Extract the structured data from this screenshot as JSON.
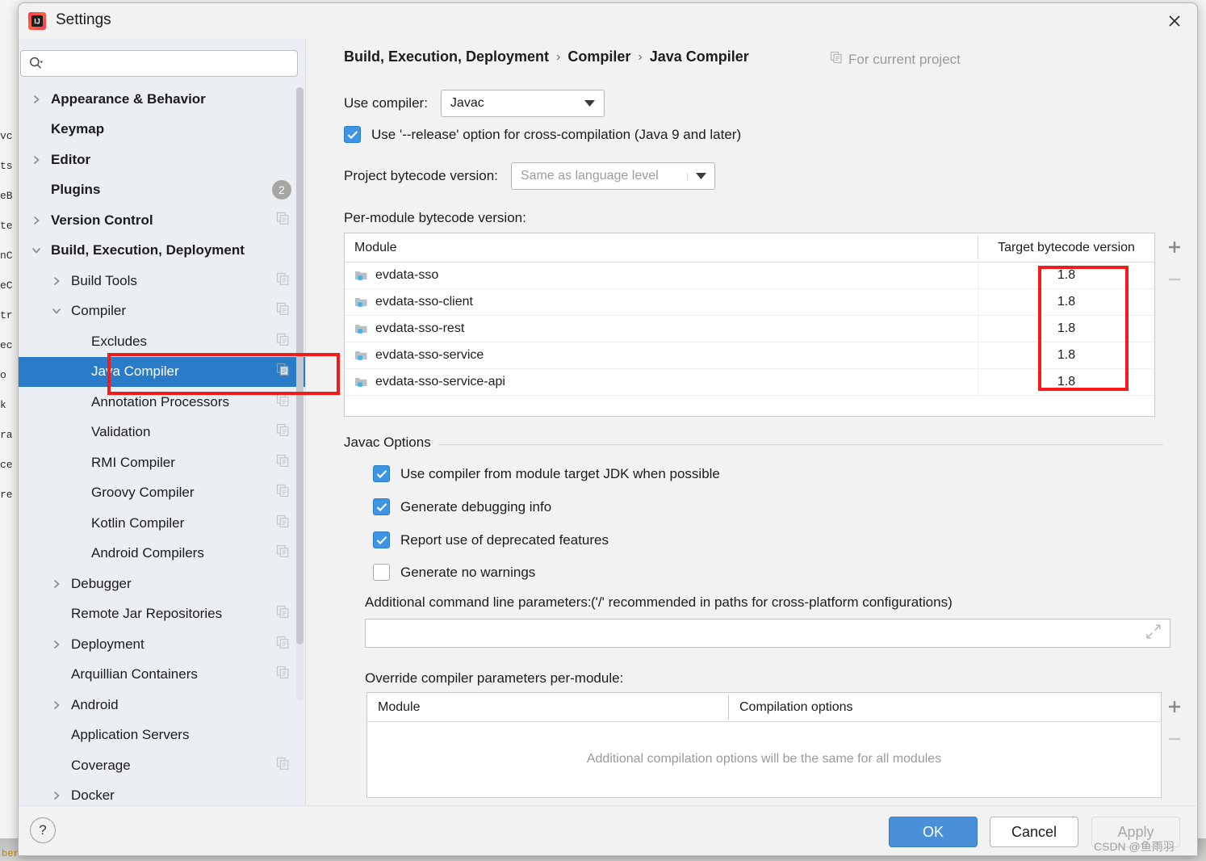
{
  "background": {
    "code_fragments": [
      "vc",
      "ts",
      "eB",
      "te",
      "nC",
      "eC",
      "tr",
      "ec",
      "o",
      "k",
      "ra",
      "ce",
      "re"
    ],
    "bottom_text": "ber/file./user/."
  },
  "window": {
    "title": "Settings",
    "logo_icon": "intellij-idea-logo",
    "close_icon": "close-icon"
  },
  "search": {
    "value": "",
    "placeholder": "",
    "icon": "search-icon"
  },
  "sidebar": {
    "items": [
      {
        "label": "Appearance & Behavior",
        "indent": 0,
        "arrow": "chevron-right",
        "bold": true,
        "copy": false,
        "badge": null,
        "selected": false
      },
      {
        "label": "Keymap",
        "indent": 0,
        "arrow": "none",
        "bold": true,
        "copy": false,
        "badge": null,
        "selected": false
      },
      {
        "label": "Editor",
        "indent": 0,
        "arrow": "chevron-right",
        "bold": true,
        "copy": false,
        "badge": null,
        "selected": false
      },
      {
        "label": "Plugins",
        "indent": 0,
        "arrow": "none",
        "bold": true,
        "copy": false,
        "badge": "2",
        "selected": false
      },
      {
        "label": "Version Control",
        "indent": 0,
        "arrow": "chevron-right",
        "bold": true,
        "copy": true,
        "badge": null,
        "selected": false
      },
      {
        "label": "Build, Execution, Deployment",
        "indent": 0,
        "arrow": "chevron-down",
        "bold": true,
        "copy": false,
        "badge": null,
        "selected": false
      },
      {
        "label": "Build Tools",
        "indent": 1,
        "arrow": "chevron-right",
        "bold": false,
        "copy": true,
        "badge": null,
        "selected": false
      },
      {
        "label": "Compiler",
        "indent": 1,
        "arrow": "chevron-down",
        "bold": false,
        "copy": true,
        "badge": null,
        "selected": false
      },
      {
        "label": "Excludes",
        "indent": 2,
        "arrow": "none",
        "bold": false,
        "copy": true,
        "badge": null,
        "selected": false
      },
      {
        "label": "Java Compiler",
        "indent": 2,
        "arrow": "none",
        "bold": false,
        "copy": true,
        "badge": null,
        "selected": true
      },
      {
        "label": "Annotation Processors",
        "indent": 2,
        "arrow": "none",
        "bold": false,
        "copy": true,
        "badge": null,
        "selected": false
      },
      {
        "label": "Validation",
        "indent": 2,
        "arrow": "none",
        "bold": false,
        "copy": true,
        "badge": null,
        "selected": false
      },
      {
        "label": "RMI Compiler",
        "indent": 2,
        "arrow": "none",
        "bold": false,
        "copy": true,
        "badge": null,
        "selected": false
      },
      {
        "label": "Groovy Compiler",
        "indent": 2,
        "arrow": "none",
        "bold": false,
        "copy": true,
        "badge": null,
        "selected": false
      },
      {
        "label": "Kotlin Compiler",
        "indent": 2,
        "arrow": "none",
        "bold": false,
        "copy": true,
        "badge": null,
        "selected": false
      },
      {
        "label": "Android Compilers",
        "indent": 2,
        "arrow": "none",
        "bold": false,
        "copy": true,
        "badge": null,
        "selected": false
      },
      {
        "label": "Debugger",
        "indent": 1,
        "arrow": "chevron-right",
        "bold": false,
        "copy": false,
        "badge": null,
        "selected": false
      },
      {
        "label": "Remote Jar Repositories",
        "indent": 1,
        "arrow": "none",
        "bold": false,
        "copy": true,
        "badge": null,
        "selected": false
      },
      {
        "label": "Deployment",
        "indent": 1,
        "arrow": "chevron-right",
        "bold": false,
        "copy": true,
        "badge": null,
        "selected": false
      },
      {
        "label": "Arquillian Containers",
        "indent": 1,
        "arrow": "none",
        "bold": false,
        "copy": true,
        "badge": null,
        "selected": false
      },
      {
        "label": "Android",
        "indent": 1,
        "arrow": "chevron-right",
        "bold": false,
        "copy": false,
        "badge": null,
        "selected": false
      },
      {
        "label": "Application Servers",
        "indent": 1,
        "arrow": "none",
        "bold": false,
        "copy": false,
        "badge": null,
        "selected": false
      },
      {
        "label": "Coverage",
        "indent": 1,
        "arrow": "none",
        "bold": false,
        "copy": true,
        "badge": null,
        "selected": false
      },
      {
        "label": "Docker",
        "indent": 1,
        "arrow": "chevron-right",
        "bold": false,
        "copy": false,
        "badge": null,
        "selected": false
      }
    ]
  },
  "breadcrumb": {
    "part1": "Build, Execution, Deployment",
    "part2": "Compiler",
    "part3": "Java Compiler",
    "separator": "›",
    "for_project_label": "For current project",
    "for_project_icon": "copy-icon"
  },
  "compiler": {
    "use_compiler_label": "Use compiler:",
    "use_compiler_value": "Javac",
    "release_option_label": "Use '--release' option for cross-compilation (Java 9 and later)",
    "release_option_checked": true,
    "bytecode_label": "Project bytecode version:",
    "bytecode_value": "Same as language level",
    "per_module_label": "Per-module bytecode version:"
  },
  "module_table": {
    "col_module": "Module",
    "col_target": "Target bytecode version",
    "add_icon": "plus-icon",
    "remove_icon": "minus-icon",
    "rows": [
      {
        "module": "evdata-sso",
        "target": "1.8",
        "icon": "module-folder-icon"
      },
      {
        "module": "evdata-sso-client",
        "target": "1.8",
        "icon": "module-folder-icon"
      },
      {
        "module": "evdata-sso-rest",
        "target": "1.8",
        "icon": "module-folder-icon"
      },
      {
        "module": "evdata-sso-service",
        "target": "1.8",
        "icon": "module-folder-icon"
      },
      {
        "module": "evdata-sso-service-api",
        "target": "1.8",
        "icon": "module-folder-icon"
      }
    ]
  },
  "javac_options": {
    "group_label": "Javac Options",
    "checkboxes": [
      {
        "label": "Use compiler from module target JDK when possible",
        "checked": true
      },
      {
        "label": "Generate debugging info",
        "checked": true
      },
      {
        "label": "Report use of deprecated features",
        "checked": true
      },
      {
        "label": "Generate no warnings",
        "checked": false
      }
    ],
    "additional_params_label": "Additional command line parameters:",
    "additional_params_hint": "('/' recommended in paths for cross-platform configurations)",
    "additional_params_value": "",
    "expand_icon": "expand-icon",
    "override_label": "Override compiler parameters per-module:"
  },
  "override_table": {
    "col_module": "Module",
    "col_options": "Compilation options",
    "empty_message": "Additional compilation options will be the same for all modules",
    "add_icon": "plus-icon",
    "remove_icon": "minus-icon"
  },
  "footer": {
    "help_label": "?",
    "ok_label": "OK",
    "cancel_label": "Cancel",
    "apply_label": "Apply",
    "watermark": "CSDN @鱼雨羽"
  },
  "colors": {
    "accent_blue": "#2a7bc8",
    "ok_button": "#4a90d9",
    "checkbox_blue": "#3d93e4",
    "annotation_red": "#f61b1b",
    "sidebar_bg": "#ebeef2",
    "panel_bg": "#f2f2f2"
  }
}
